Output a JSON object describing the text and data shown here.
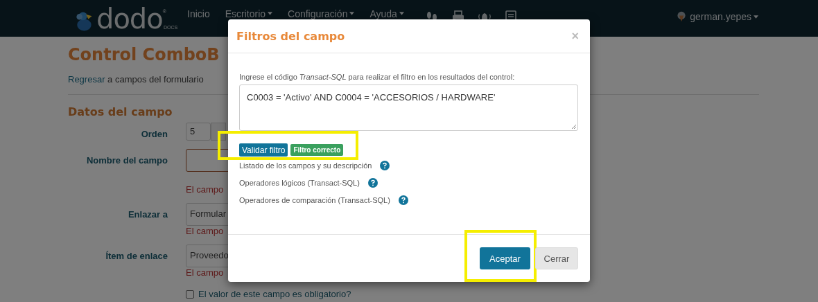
{
  "navbar": {
    "logo_text": "dodo",
    "logo_mark": "®",
    "logo_sub": "DOCS",
    "menu": [
      {
        "label": "Inicio",
        "dropdown": false
      },
      {
        "label": "Escritorio",
        "dropdown": true
      },
      {
        "label": "Configuración",
        "dropdown": true
      },
      {
        "label": "Ayuda",
        "dropdown": true
      }
    ],
    "user": "german.yepes"
  },
  "page": {
    "title": "Control ComboB",
    "back_link": "Regresar",
    "back_text": "a campos del formulario",
    "section": "Datos del campo",
    "fields": [
      {
        "kind": "number",
        "label": "Orden",
        "value": "5",
        "invalid": false
      },
      {
        "kind": "text",
        "label": "Nombre del campo",
        "invalid": true,
        "error": "El campo"
      },
      {
        "kind": "select",
        "label": "Enlazar a",
        "value": "Formular",
        "invalid": false,
        "error": "El campo"
      },
      {
        "kind": "select",
        "label": "Ítem de enlace",
        "value": "Proveedo",
        "invalid": false,
        "error": "El campo"
      }
    ],
    "required_checkbox": {
      "label": "El valor de este campo es obligatorio?",
      "checked": false
    }
  },
  "modal": {
    "title": "Filtros del campo",
    "close": "×",
    "instruction": "Ingrese el código *Transact-SQL* para realizar el filtro en los resultados del control:",
    "filter_value": "C0003 = 'Activo' AND C0004 = 'ACCESORIOS / HARDWARE'",
    "validate_button": "Validar filtro",
    "status_badge": "Filtro correcto",
    "validate_highlighted": true,
    "help_links": [
      "Listado de los campos y su descripción",
      "Operadores lógicos (Transact-SQL)",
      "Operadores de comparación (Transact-SQL)"
    ],
    "buttons": [
      {
        "label": "Aceptar",
        "kind": "primary",
        "highlighted": true
      },
      {
        "label": "Cerrar",
        "kind": "secondary",
        "highlighted": false
      }
    ]
  }
}
